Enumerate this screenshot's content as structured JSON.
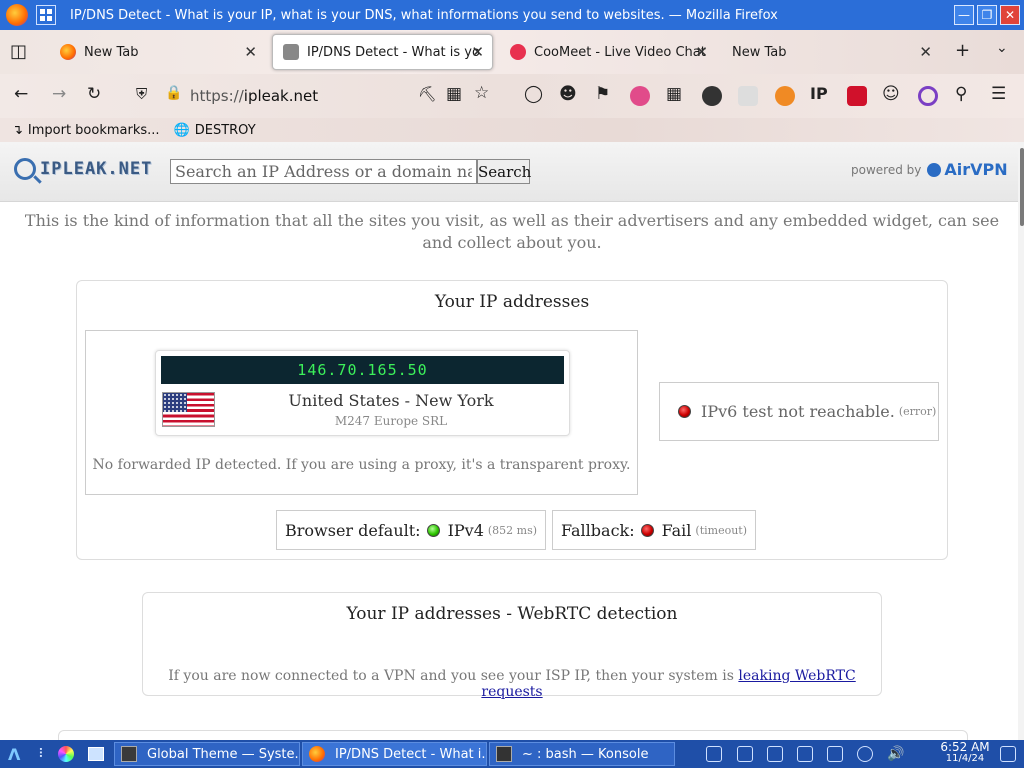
{
  "window": {
    "title": "IP/DNS Detect - What is your IP, what is your DNS, what informations you send to websites. — Mozilla Firefox"
  },
  "tabs": [
    {
      "label": "New Tab"
    },
    {
      "label": "IP/DNS Detect - What is yo"
    },
    {
      "label": "CooMeet - Live Video Chat"
    },
    {
      "label": "New Tab"
    }
  ],
  "nav": {
    "url_scheme": "https://",
    "url_host": "ipleak.net"
  },
  "bookmarks": [
    {
      "label": "Import bookmarks..."
    },
    {
      "label": "DESTROY"
    }
  ],
  "site": {
    "logo": "IPLEAK.NET",
    "search_placeholder": "Search an IP Address or a domain name",
    "search_button": "Search",
    "powered_by": "powered by",
    "brand": "AirVPN",
    "intro": "This is the kind of information that all the sites you visit, as well as their advertisers and any embedded widget, can see and collect about you."
  },
  "ip_section": {
    "title": "Your IP addresses",
    "ip": "146.70.165.50",
    "location": "United States - New York",
    "isp": "M247 Europe SRL",
    "forwarded": "No forwarded IP detected. If you are using a proxy, it's a transparent proxy.",
    "ipv6_text": "IPv6 test not reachable.",
    "ipv6_note": "(error)",
    "browser_default_label": "Browser default:",
    "browser_default_value": "IPv4",
    "browser_default_ms": "(852 ms)",
    "fallback_label": "Fallback:",
    "fallback_value": "Fail",
    "fallback_note": "(timeout)"
  },
  "webrtc": {
    "title": "Your IP addresses - WebRTC detection",
    "text": "If you are now connected to a VPN and you see your ISP IP, then your system is",
    "link": "leaking WebRTC requests"
  },
  "taskbar": {
    "tasks": [
      {
        "label": "Global Theme — Syste..."
      },
      {
        "label": "IP/DNS Detect - What i..."
      },
      {
        "label": "~ : bash — Konsole"
      }
    ],
    "time": "6:52 AM",
    "date": "11/4/24"
  },
  "colors": {
    "titlebar": "#2b6ed8",
    "taskbar": "#1f4fa8",
    "ip_display_bg": "#0c2630",
    "ip_display_fg": "#3cf05a",
    "brand": "#2a6cc4"
  }
}
